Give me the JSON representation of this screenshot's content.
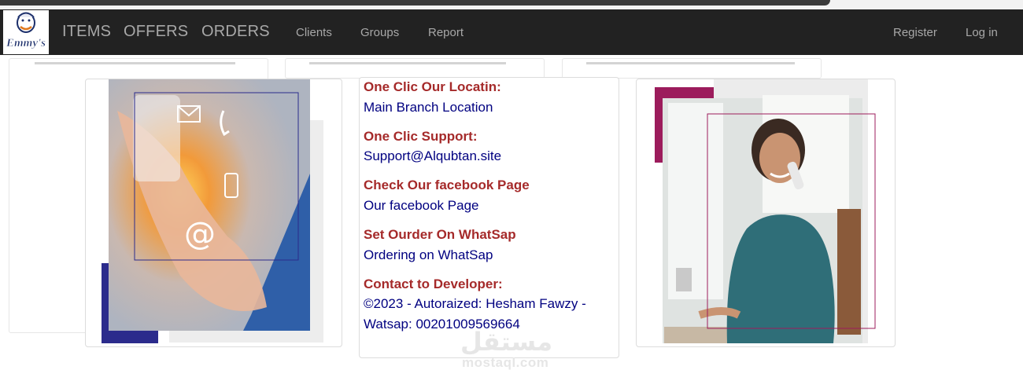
{
  "navbar": {
    "logo_text": "Emmy's",
    "primary_links": [
      "ITEMS",
      "OFFERS",
      "ORDERS"
    ],
    "secondary_links": [
      "Clients",
      "Groups",
      "Report"
    ],
    "right_links": [
      "Register",
      "Log in"
    ]
  },
  "contact": {
    "location_title": "One Clic Our Locatin:",
    "location_link": "Main Branch Location",
    "support_title": "One Clic Support:",
    "support_link": "Support@Alqubtan.site",
    "facebook_title": "Check Our facebook Page",
    "facebook_link": "Our facebook Page",
    "whatsapp_title": "Set Ourder On WhatSap",
    "whatsapp_link": "Ordering on WhatSap",
    "developer_title": "Contact to Developer:",
    "developer_line1": "©2023 - Autoraized: Hesham Fawzy -",
    "developer_line2": "Watsap: 00201009569664"
  },
  "watermark": {
    "arabic": "مستقل",
    "latin": "mostaql.com"
  },
  "colors": {
    "navbar_bg": "#222222",
    "nav_text": "#a8a8a8",
    "title_red": "#a52a2a",
    "link_navy": "#000080",
    "accent_indigo": "#2b2b8c",
    "accent_magenta": "#9c1c5c"
  },
  "icons": [
    "email-icon",
    "phone-icon",
    "at-icon",
    "mobile-icon"
  ]
}
